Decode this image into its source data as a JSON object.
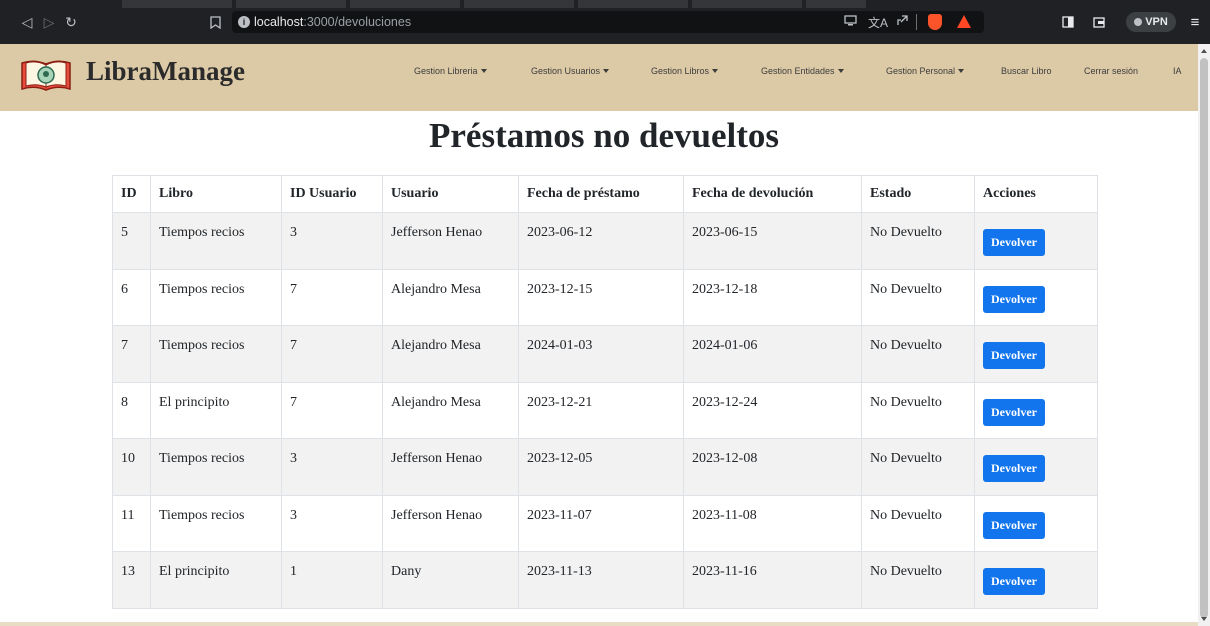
{
  "browser": {
    "url_host": "localhost",
    "url_path": ":3000/devoluciones",
    "vpn_label": "VPN"
  },
  "header": {
    "brand": "LibraManage",
    "nav": [
      {
        "label": "Gestion Libreria",
        "dropdown": true
      },
      {
        "label": "Gestion Usuarios",
        "dropdown": true
      },
      {
        "label": "Gestion Libros",
        "dropdown": true
      },
      {
        "label": "Gestion Entidades",
        "dropdown": true
      },
      {
        "label": "Gestion Personal",
        "dropdown": true
      },
      {
        "label": "Buscar Libro",
        "dropdown": false
      },
      {
        "label": "Cerrar sesión",
        "dropdown": false
      },
      {
        "label": "IA",
        "dropdown": false
      }
    ]
  },
  "page": {
    "title": "Préstamos no devueltos"
  },
  "table": {
    "columns": [
      "ID",
      "Libro",
      "ID Usuario",
      "Usuario",
      "Fecha de préstamo",
      "Fecha de devolución",
      "Estado",
      "Acciones"
    ],
    "action_label": "Devolver",
    "rows": [
      {
        "id": "5",
        "libro": "Tiempos recios",
        "id_usuario": "3",
        "usuario": "Jefferson Henao",
        "fecha_prestamo": "2023-06-12",
        "fecha_devolucion": "2023-06-15",
        "estado": "No Devuelto"
      },
      {
        "id": "6",
        "libro": "Tiempos recios",
        "id_usuario": "7",
        "usuario": "Alejandro Mesa",
        "fecha_prestamo": "2023-12-15",
        "fecha_devolucion": "2023-12-18",
        "estado": "No Devuelto"
      },
      {
        "id": "7",
        "libro": "Tiempos recios",
        "id_usuario": "7",
        "usuario": "Alejandro Mesa",
        "fecha_prestamo": "2024-01-03",
        "fecha_devolucion": "2024-01-06",
        "estado": "No Devuelto"
      },
      {
        "id": "8",
        "libro": "El principito",
        "id_usuario": "7",
        "usuario": "Alejandro Mesa",
        "fecha_prestamo": "2023-12-21",
        "fecha_devolucion": "2023-12-24",
        "estado": "No Devuelto"
      },
      {
        "id": "10",
        "libro": "Tiempos recios",
        "id_usuario": "3",
        "usuario": "Jefferson Henao",
        "fecha_prestamo": "2023-12-05",
        "fecha_devolucion": "2023-12-08",
        "estado": "No Devuelto"
      },
      {
        "id": "11",
        "libro": "Tiempos recios",
        "id_usuario": "3",
        "usuario": "Jefferson Henao",
        "fecha_prestamo": "2023-11-07",
        "fecha_devolucion": "2023-11-08",
        "estado": "No Devuelto"
      },
      {
        "id": "13",
        "libro": "El principito",
        "id_usuario": "1",
        "usuario": "Dany",
        "fecha_prestamo": "2023-11-13",
        "fecha_devolucion": "2023-11-16",
        "estado": "No Devuelto"
      }
    ]
  },
  "colors": {
    "header_bg": "#dccaa7",
    "button_bg": "#1275ee",
    "row_stripe": "#f2f2f2"
  }
}
